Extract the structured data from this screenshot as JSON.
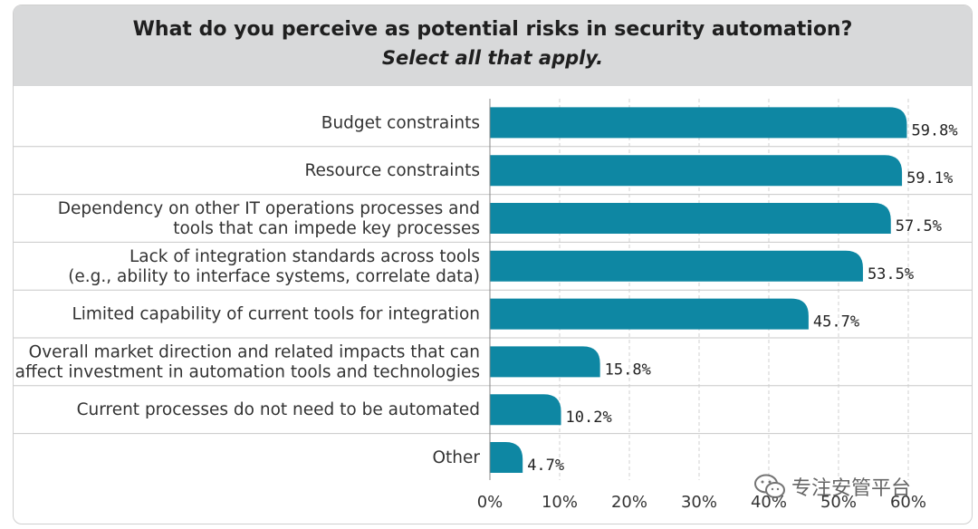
{
  "header": {
    "title": "What do you perceive as potential risks in security automation?",
    "subtitle": "Select all that apply."
  },
  "watermark": {
    "text": "专注安管平台",
    "icon": "wechat-icon"
  },
  "colors": {
    "bar": "#0e87a3",
    "header_bg": "#d8d9da",
    "grid": "#c8c8c8"
  },
  "chart_data": {
    "type": "bar",
    "orientation": "horizontal",
    "title": "What do you perceive as potential risks in security automation?",
    "subtitle": "Select all that apply.",
    "categories": [
      [
        "Budget constraints"
      ],
      [
        "Resource constraints"
      ],
      [
        "Dependency on other IT operations processes and",
        "tools that can impede key processes"
      ],
      [
        "Lack of integration standards across tools",
        "(e.g., ability to interface systems, correlate data)"
      ],
      [
        "Limited capability of current tools for integration"
      ],
      [
        "Overall market direction and related impacts that can",
        "affect investment in automation tools and technologies"
      ],
      [
        "Current processes do not need to be automated"
      ],
      [
        "Other"
      ]
    ],
    "values": [
      59.8,
      59.1,
      57.5,
      53.5,
      45.7,
      15.8,
      10.2,
      4.7
    ],
    "value_labels": [
      "59.8%",
      "59.1%",
      "57.5%",
      "53.5%",
      "45.7%",
      "15.8%",
      "10.2%",
      "4.7%"
    ],
    "xlim": [
      0,
      60
    ],
    "xticks": [
      0,
      10,
      20,
      30,
      40,
      50,
      60
    ],
    "xtick_labels": [
      "0%",
      "10%",
      "20%",
      "30%",
      "40%",
      "50%",
      "60%"
    ],
    "grid": true
  }
}
